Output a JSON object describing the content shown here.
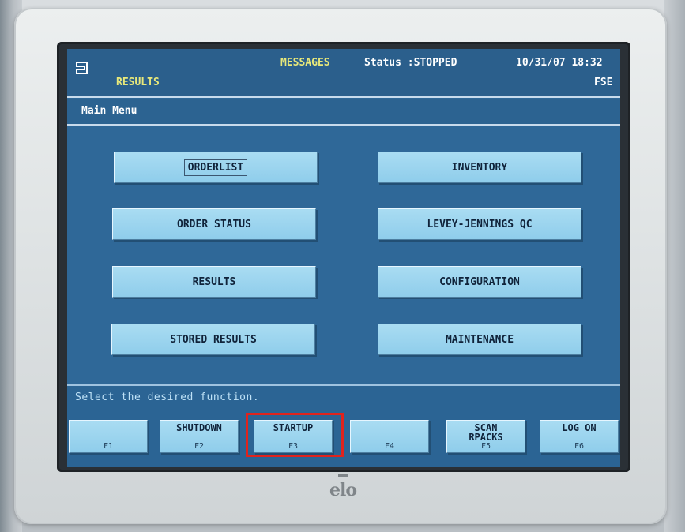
{
  "header": {
    "section": "RESULTS",
    "messages": "MESSAGES",
    "status": "Status :STOPPED",
    "datetime": "10/31/07 18:32",
    "user": "FSE",
    "logo_icon": "abbott-logo-icon"
  },
  "subheader": {
    "title": "Main Menu"
  },
  "menu": {
    "orderlist": "ORDERLIST",
    "inventory": "INVENTORY",
    "order_status": "ORDER STATUS",
    "levey_jennings": "LEVEY-JENNINGS QC",
    "results": "RESULTS",
    "configuration": "CONFIGURATION",
    "stored_results": "STORED RESULTS",
    "maintenance": "MAINTENANCE"
  },
  "prompt": "Select the desired function.",
  "function_keys": [
    {
      "label": "",
      "key": "F1"
    },
    {
      "label": "SHUTDOWN",
      "key": "F2"
    },
    {
      "label": "STARTUP",
      "key": "F3"
    },
    {
      "label": "",
      "key": "F4"
    },
    {
      "label": "SCAN\nRPACKS",
      "key": "F5"
    },
    {
      "label": "LOG ON",
      "key": "F6"
    }
  ],
  "monitor_brand": "elo",
  "colors": {
    "screen_bg": "#2f6898",
    "button_bg": "#8fcdeb",
    "header_yellow": "#e8e87a",
    "highlight_red": "#e0231d"
  }
}
